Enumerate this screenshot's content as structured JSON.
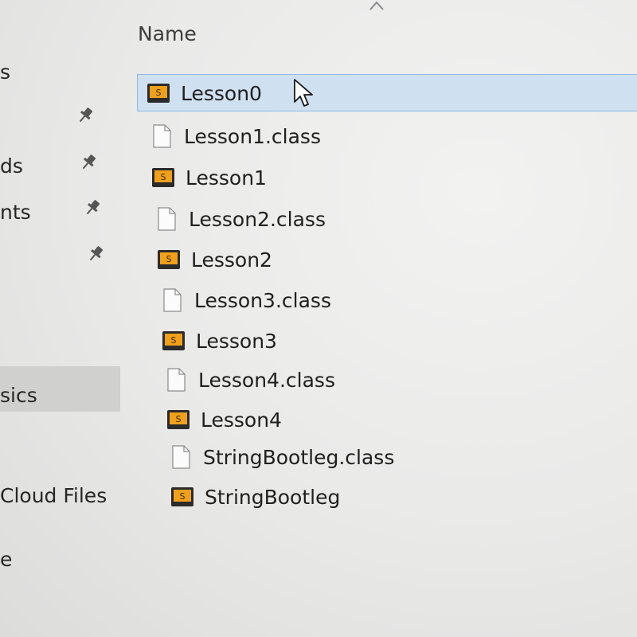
{
  "header": {
    "name_column": "Name"
  },
  "nav": {
    "items": [
      {
        "label": "s"
      },
      {
        "label": "ds"
      },
      {
        "label": "nts"
      },
      {
        "label": "sics"
      },
      {
        "label": "Cloud Files"
      },
      {
        "label": "e"
      }
    ]
  },
  "files": [
    {
      "name": "Lesson0",
      "icon": "sublime-text-icon",
      "selected": true
    },
    {
      "name": "Lesson1.class",
      "icon": "class-file-icon"
    },
    {
      "name": "Lesson1",
      "icon": "sublime-text-icon"
    },
    {
      "name": "Lesson2.class",
      "icon": "class-file-icon"
    },
    {
      "name": "Lesson2",
      "icon": "sublime-text-icon"
    },
    {
      "name": "Lesson3.class",
      "icon": "class-file-icon"
    },
    {
      "name": "Lesson3",
      "icon": "sublime-text-icon"
    },
    {
      "name": "Lesson4.class",
      "icon": "class-file-icon"
    },
    {
      "name": "Lesson4",
      "icon": "sublime-text-icon"
    },
    {
      "name": "StringBootleg.class",
      "icon": "class-file-icon"
    },
    {
      "name": "StringBootleg",
      "icon": "sublime-text-icon"
    }
  ],
  "colors": {
    "selection_fill": "#cfe0f1",
    "selection_border": "#8fb9e2",
    "nav_selected": "#d0d0ce",
    "sublime_icon": "#f0a019"
  }
}
